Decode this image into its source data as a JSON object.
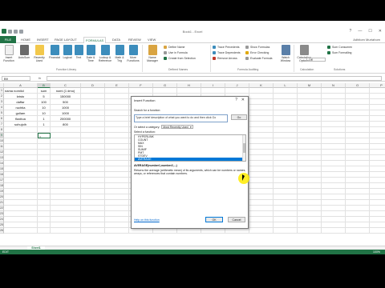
{
  "window": {
    "title": "Book1 - Excel",
    "user": "Adhitom Murtahom",
    "controls": [
      "?",
      "—",
      "☐",
      "✕"
    ]
  },
  "tabs": [
    "FILE",
    "HOME",
    "INSERT",
    "PAGE LAYOUT",
    "FORMULAS",
    "DATA",
    "REVIEW",
    "VIEW"
  ],
  "active_tab": "FORMULAS",
  "ribbon": {
    "big_buttons": [
      "Insert Function",
      "AutoSum",
      "Recently Used",
      "Financial",
      "Logical",
      "Text",
      "Date & Time",
      "Lookup & Reference",
      "Math & Trig",
      "More Functions",
      "Name Manager",
      "Watch Window",
      "Calculation Options"
    ],
    "defined_names": [
      "Define Name",
      "Use in Formula",
      "Create from Selection"
    ],
    "auditing": [
      "Trace Precedents",
      "Trace Dependents",
      "Remove Arrows",
      "Show Formulas",
      "Error Checking",
      "Evaluate Formula"
    ],
    "right_small": [
      "Sum Consumen",
      "Sum Formalling"
    ],
    "dropdown_value": "Off",
    "groups": [
      "Function Library",
      "Defined Names",
      "Formula Auditing",
      "Calculation",
      "Solutions"
    ]
  },
  "formula_bar": {
    "name_box": "B9",
    "fx": "fx",
    "value": ""
  },
  "columns": [
    "A",
    "B",
    "C",
    "D",
    "E",
    "F",
    "G",
    "H",
    "I",
    "J",
    "K",
    "L",
    "M",
    "N",
    "O",
    "P"
  ],
  "rows": [
    "1",
    "2",
    "3",
    "4",
    "5",
    "6",
    "7",
    "8",
    "9",
    "10",
    "11",
    "12",
    "13",
    "14",
    "15",
    "16",
    "17",
    "18",
    "19",
    "20",
    "21",
    "22",
    "23",
    "24",
    "25",
    "26"
  ],
  "table": {
    "headers": [
      "nama nomilol",
      "sum",
      "nomi (1 dmo)"
    ],
    "rows": [
      [
        "kristo",
        "5",
        "150000"
      ],
      [
        "daffar",
        "100",
        "500"
      ],
      [
        "ruchtia",
        "10",
        "1000"
      ],
      [
        "gollam",
        "10",
        "1000"
      ],
      [
        "flaxitoa",
        "1",
        "200000"
      ],
      [
        "sohujoih",
        "1",
        "800"
      ]
    ],
    "active_cell_text": "="
  },
  "dialog": {
    "title": "Insert Function",
    "help": "?",
    "close": "✕",
    "search_label": "Search for a function:",
    "search_placeholder": "Type a brief description of what you want to do and then click Go",
    "go": "Go",
    "category_label": "Or select a category:",
    "category_value": "Most Recently Used",
    "select_label": "Select a function:",
    "functions": [
      "HYPERLINK",
      "COUNT",
      "MAX",
      "SIN",
      "SUMIF",
      "PMT",
      "STDEV"
    ],
    "selected_function": "AVERAGE",
    "signature": "AVERAGE(number1,number2,...)",
    "description": "Returns the average (arithmetic mean) of its arguments, which can be numbers or names, arrays, or references that contain numbers.",
    "help_link": "Help on this function",
    "ok": "OK",
    "cancel": "Cancel"
  },
  "sheet": {
    "tab": "Sheet1",
    "status": "EDIT",
    "zoom": "100%"
  },
  "colors": {
    "excel_green": "#217346",
    "selection_blue": "#0078d7",
    "highlight_yellow": "#ffeb00"
  }
}
